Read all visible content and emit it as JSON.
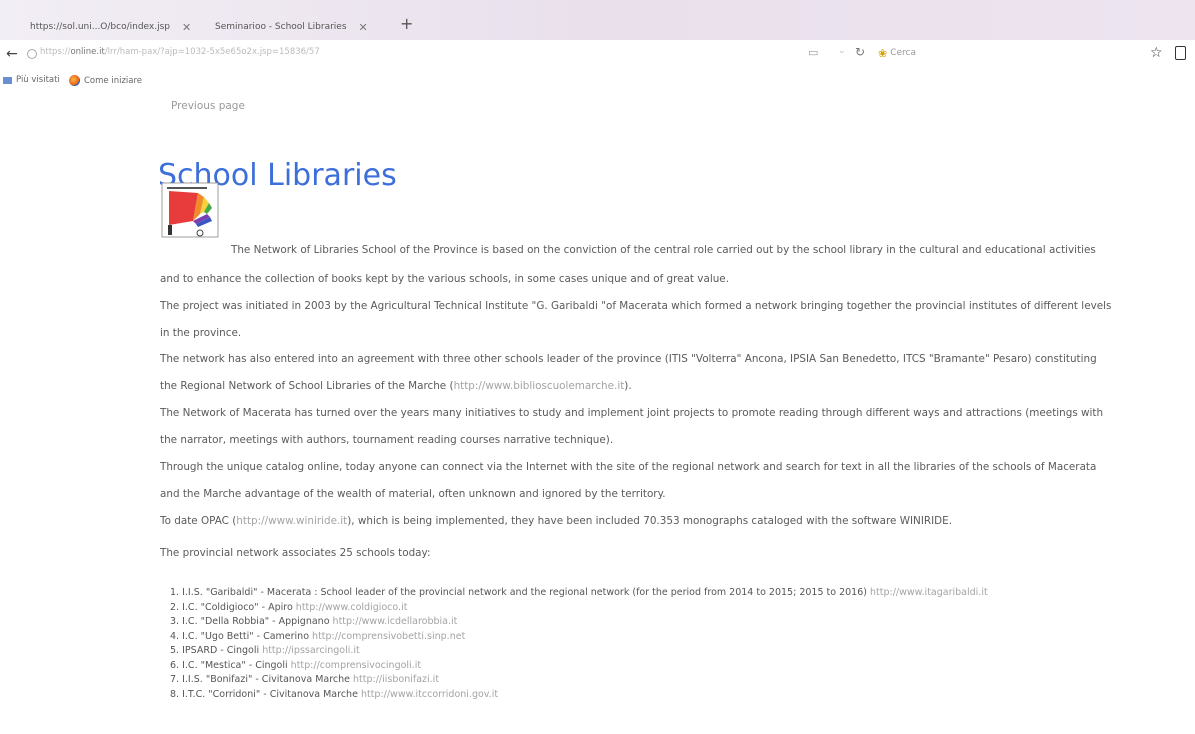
{
  "browser": {
    "tabs": [
      {
        "title": "https://sol.uni...O/bco/index.jsp"
      },
      {
        "title": "Seminarioo - School Libraries"
      }
    ],
    "new_tab": "+",
    "url_domain": "online.it",
    "url_rest": "/lrr/ham-pax/?ajp=1032-5x5e65o2x.jsp=15836/57",
    "search_placeholder": "Cerca",
    "bookmarks": [
      "Più visitati",
      "Come iniziare"
    ]
  },
  "page": {
    "previous_link": "Previous page",
    "title": "School Libraries",
    "paragraphs": [
      {
        "lines": [
          "The Network of Libraries School of the Province is based on the conviction of the central role carried out by the school library in the cultural and educational activities",
          "and to enhance the collection of books kept by the various schools, in some cases unique and of great value."
        ]
      },
      {
        "lines": [
          "The project was initiated in 2003 by the Agricultural Technical Institute \"G. Garibaldi \"of Macerata which formed a network bringing together the provincial institutes of different levels",
          "in the province."
        ]
      },
      {
        "lines_pre": [
          "The network has also entered into an agreement with three other schools leader of the province (ITIS \"Volterra\" Ancona, IPSIA San Benedetto, ITCS \"Bramante\" Pesaro) constituting"
        ],
        "line2_pre": "the Regional Network of School Libraries of the Marche (",
        "line2_link": "http://www.biblioscuolemarche.it",
        "line2_post": ")."
      },
      {
        "lines": [
          "The Network of Macerata has turned over the years many initiatives to study and implement joint projects to promote reading through different ways and attractions (meetings with",
          "the narrator, meetings with authors, tournament reading courses narrative technique)."
        ]
      },
      {
        "lines": [
          "Through the unique catalog online, today anyone can connect via the Internet with the site of the regional network and search for text in all the libraries of the schools of Macerata",
          "and the Marche advantage of the wealth of material, often unknown and ignored by the territory."
        ]
      }
    ],
    "opac_pre": "To date OPAC (",
    "opac_link": "http://www.winiride.it",
    "opac_post": "), which is being implemented, they have been included 70.353 monographs cataloged with the software WINIRIDE.",
    "associates_text": "The provincial network associates 25 schools today:",
    "schools": [
      {
        "num": "1.",
        "text": "I.I.S. \"Garibaldi\" - Macerata : School leader of the provincial network and the regional network (for the period from 2014 to 2015; 2015 to 2016)",
        "link": "http://www.itagaribaldi.it"
      },
      {
        "num": "2.",
        "text": "I.C. \"Coldigioco\" - Apiro",
        "link": "http://www.coldigioco.it"
      },
      {
        "num": "3.",
        "text": "I.C. \"Della Robbia\" - Appignano",
        "link": "http://www.icdellarobbia.it"
      },
      {
        "num": "4.",
        "text": "I.C. \"Ugo Betti\" - Camerino",
        "link": "http://comprensivobetti.sinp.net"
      },
      {
        "num": "5.",
        "text": "IPSARD - Cingoli",
        "link": "http://ipssarcingoli.it"
      },
      {
        "num": "6.",
        "text": "I.C. \"Mestica\" - Cingoli",
        "link": "http://comprensivocingoli.it"
      },
      {
        "num": "7.",
        "text": "I.I.S. \"Bonifazi\" - Civitanova Marche",
        "link": "http://iisbonifazi.it"
      },
      {
        "num": "8.",
        "text": "I.T.C. \"Corridoni\" - Civitanova Marche",
        "link": "http://www.itccorridoni.gov.it"
      }
    ]
  },
  "colors": {
    "title": "#3c6fd9",
    "link": "#a3a3a3",
    "body_text": "#5a5a5a"
  }
}
